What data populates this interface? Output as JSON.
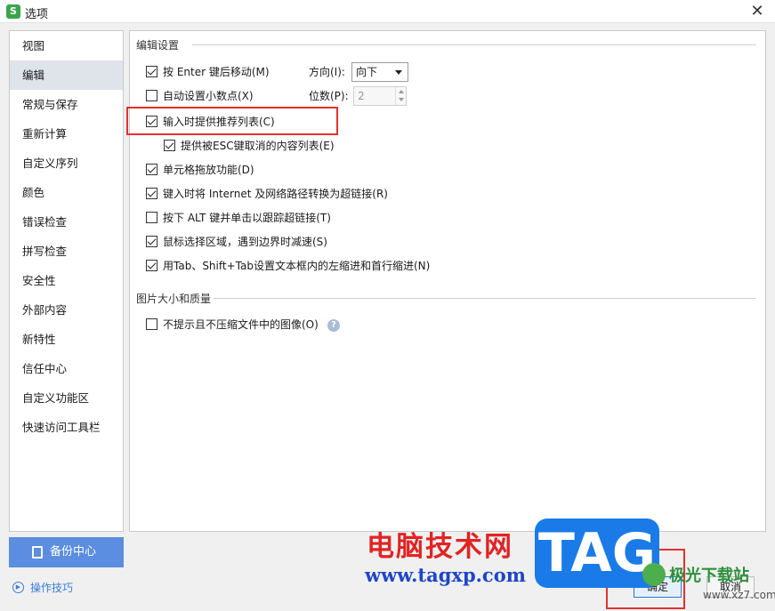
{
  "window": {
    "icon_letter": "S",
    "title": "选项",
    "close_glyph": "✕"
  },
  "sidebar": {
    "items": [
      {
        "label": "视图"
      },
      {
        "label": "编辑"
      },
      {
        "label": "常规与保存"
      },
      {
        "label": "重新计算"
      },
      {
        "label": "自定义序列"
      },
      {
        "label": "颜色"
      },
      {
        "label": "错误检查"
      },
      {
        "label": "拼写检查"
      },
      {
        "label": "安全性"
      },
      {
        "label": "外部内容"
      },
      {
        "label": "新特性"
      },
      {
        "label": "信任中心"
      },
      {
        "label": "自定义功能区"
      },
      {
        "label": "快速访问工具栏"
      }
    ],
    "active_item": "编辑",
    "backup_label": "备份中心",
    "tips_label": "操作技巧"
  },
  "edit_settings": {
    "title": "编辑设置",
    "options": [
      {
        "label": "按 Enter 键后移动(M)",
        "checked": true
      },
      {
        "label": "自动设置小数点(X)",
        "checked": false
      },
      {
        "label": "输入时提供推荐列表(C)",
        "checked": true
      },
      {
        "label": "提供被ESC键取消的内容列表(E)",
        "checked": true
      },
      {
        "label": "单元格拖放功能(D)",
        "checked": true
      },
      {
        "label": "键入时将 Internet 及网络路径转换为超链接(R)",
        "checked": true
      },
      {
        "label": "按下 ALT 键并单击以跟踪超链接(T)",
        "checked": false
      },
      {
        "label": "鼠标选择区域，遇到边界时减速(S)",
        "checked": true
      },
      {
        "label": "用Tab、Shift+Tab设置文本框内的左缩进和首行缩进(N)",
        "checked": true
      }
    ],
    "direction_label": "方向(I):",
    "direction_value": "向下",
    "decimal_label": "位数(P):",
    "decimal_value": "2"
  },
  "image_settings": {
    "title": "图片大小和质量",
    "options": [
      {
        "label": "不提示且不压缩文件中的图像(O)",
        "checked": false
      }
    ],
    "help_glyph": "?"
  },
  "buttons": {
    "ok": "确定",
    "cancel": "取消"
  },
  "watermark": {
    "site_name": "电脑技术网",
    "site_url": "www.tagxp.com",
    "tag": "TAG",
    "site2_name": "极光下载站",
    "site2_url": "www.xz7.com"
  },
  "colors": {
    "accent": "#5b8de0",
    "highlight_border": "#e4312b",
    "sidebar_active": "#dfe3ea"
  }
}
